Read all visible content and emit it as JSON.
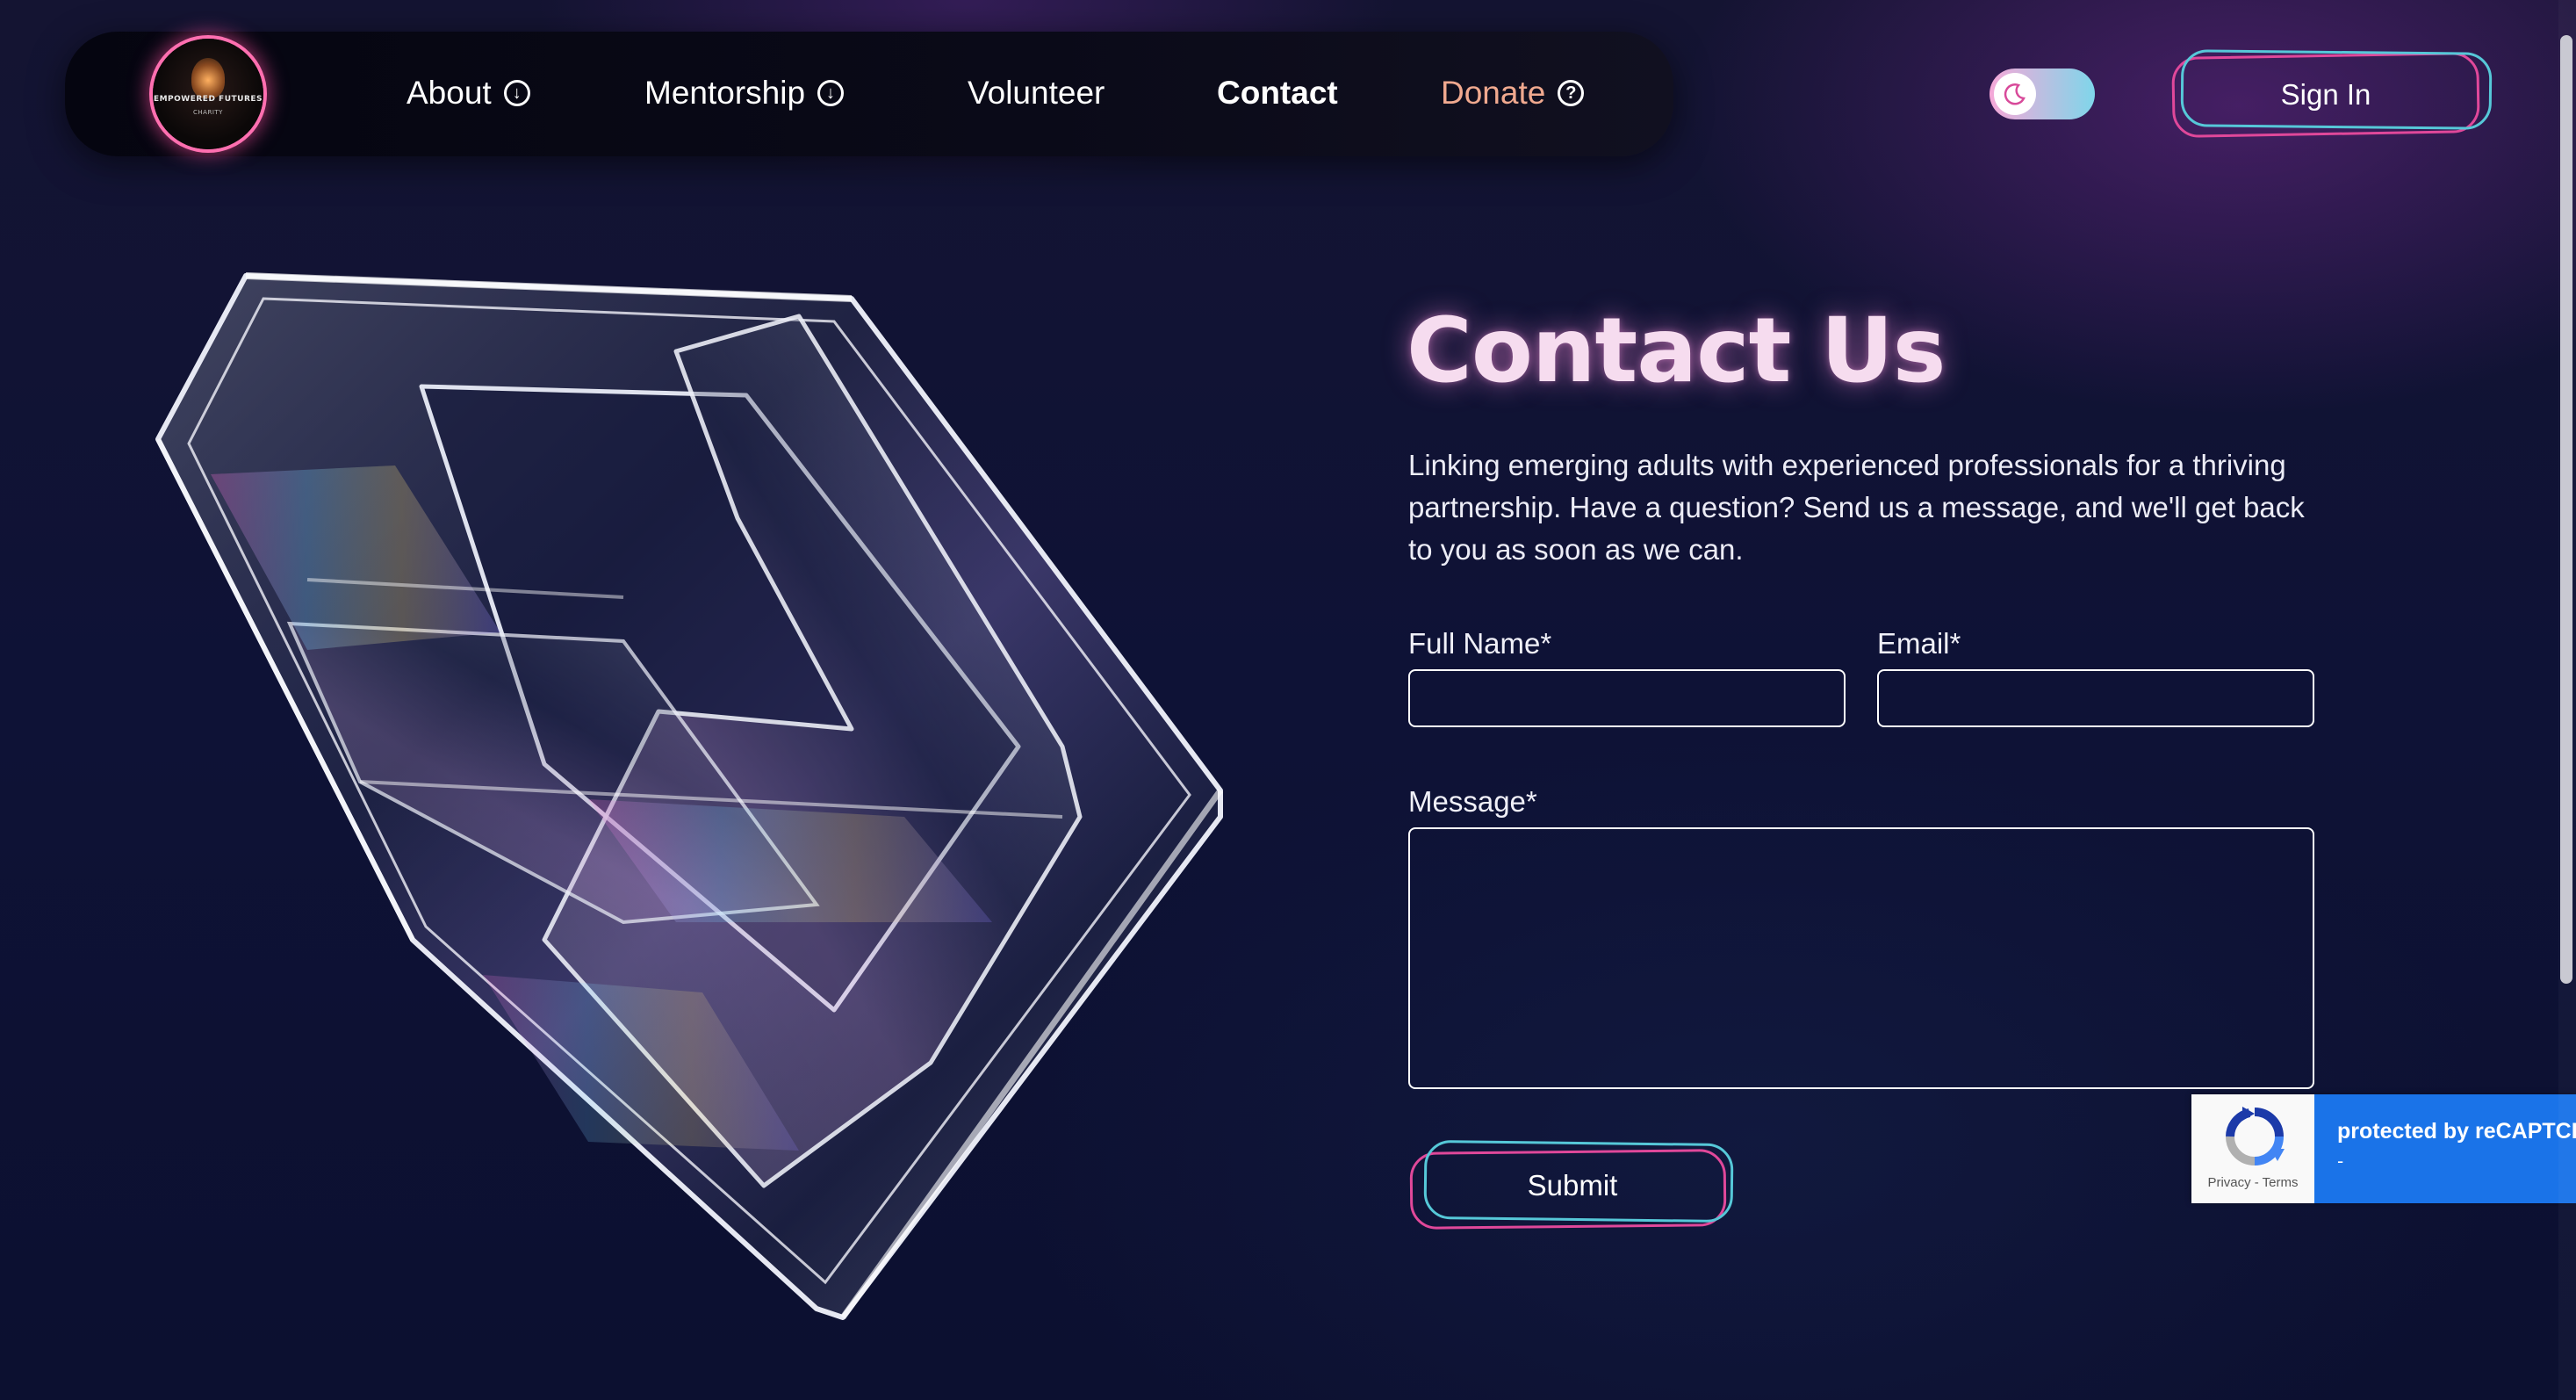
{
  "nav": {
    "logo_text": "EMPOWERED FUTURES",
    "logo_subtext": "CHARITY",
    "items": [
      {
        "label": "About",
        "icon": "chevron-circle-down-icon"
      },
      {
        "label": "Mentorship",
        "icon": "chevron-circle-down-icon"
      },
      {
        "label": "Volunteer"
      },
      {
        "label": "Contact"
      },
      {
        "label": "Donate",
        "icon": "question-circle-icon"
      }
    ],
    "theme_toggle_icon": "moon-icon",
    "sign_in_label": "Sign In"
  },
  "hero": {
    "image": "glass-3d-shape"
  },
  "contact": {
    "title": "Contact Us",
    "description": "Linking emerging adults with experienced professionals for a thriving partnership. Have a question? Send us a message, and we'll get back to you as soon as we can.",
    "full_name_label": "Full Name*",
    "full_name_value": "",
    "email_label": "Email*",
    "email_value": "",
    "message_label": "Message*",
    "message_value": "",
    "submit_label": "Submit"
  },
  "recaptcha": {
    "protected_text": "protected by reCAPTCHA",
    "links": "Privacy - Terms",
    "dash": "-"
  },
  "colors": {
    "accent_pink": "#e0489a",
    "accent_cyan": "#56c8d8",
    "donate": "#f0a98f",
    "title": "#f6dcef",
    "background": "#0e1236"
  }
}
